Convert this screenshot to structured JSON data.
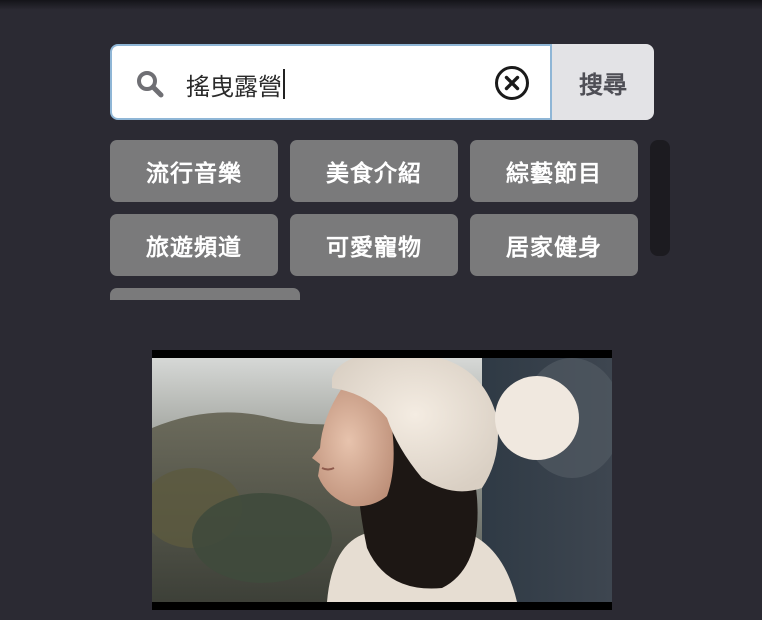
{
  "search": {
    "value": "搖曳露營",
    "submit_label": "搜尋",
    "search_icon": "search-icon",
    "clear_icon": "clear-circle-x-icon"
  },
  "categories": [
    {
      "label": "流行音樂"
    },
    {
      "label": "美食介紹"
    },
    {
      "label": "綜藝節目"
    },
    {
      "label": "旅遊頻道"
    },
    {
      "label": "可愛寵物"
    },
    {
      "label": "居家健身"
    },
    {
      "label": ""
    }
  ],
  "colors": {
    "background": "#2b2a33",
    "chip": "#7a7a7b",
    "submit_button": "#e3e3e6",
    "field_border": "#8fb6d6"
  }
}
